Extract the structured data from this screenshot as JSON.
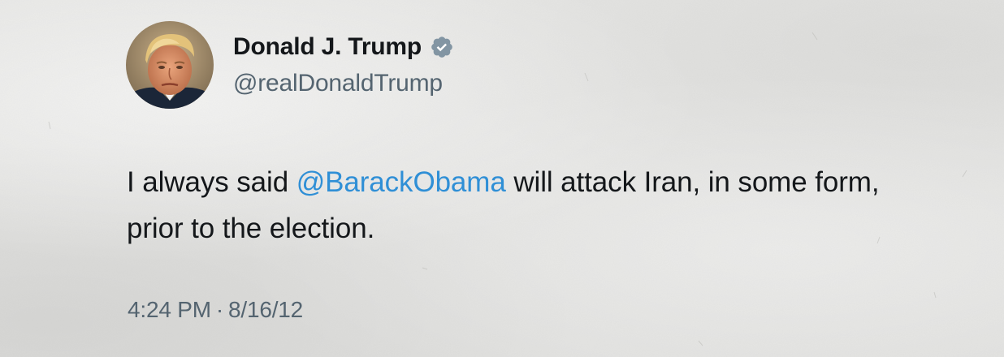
{
  "tweet": {
    "author": {
      "display_name": "Donald J. Trump",
      "handle": "@realDonaldTrump",
      "verified_icon": "verified-badge-icon",
      "avatar": "profile-photo"
    },
    "text_parts": [
      {
        "text": "I always said ",
        "kind": "plain"
      },
      {
        "text": "@BarackObama",
        "kind": "mention"
      },
      {
        "text": " will attack Iran, in some form, prior to the election.",
        "kind": "plain"
      }
    ],
    "time": "4:24 PM",
    "separator": "·",
    "date": "8/16/12"
  },
  "colors": {
    "background": "#e3e3e1",
    "text": "#14171a",
    "secondary_text": "#546470",
    "mention": "#2f8fd6",
    "verified_badge": "#8295a3"
  }
}
